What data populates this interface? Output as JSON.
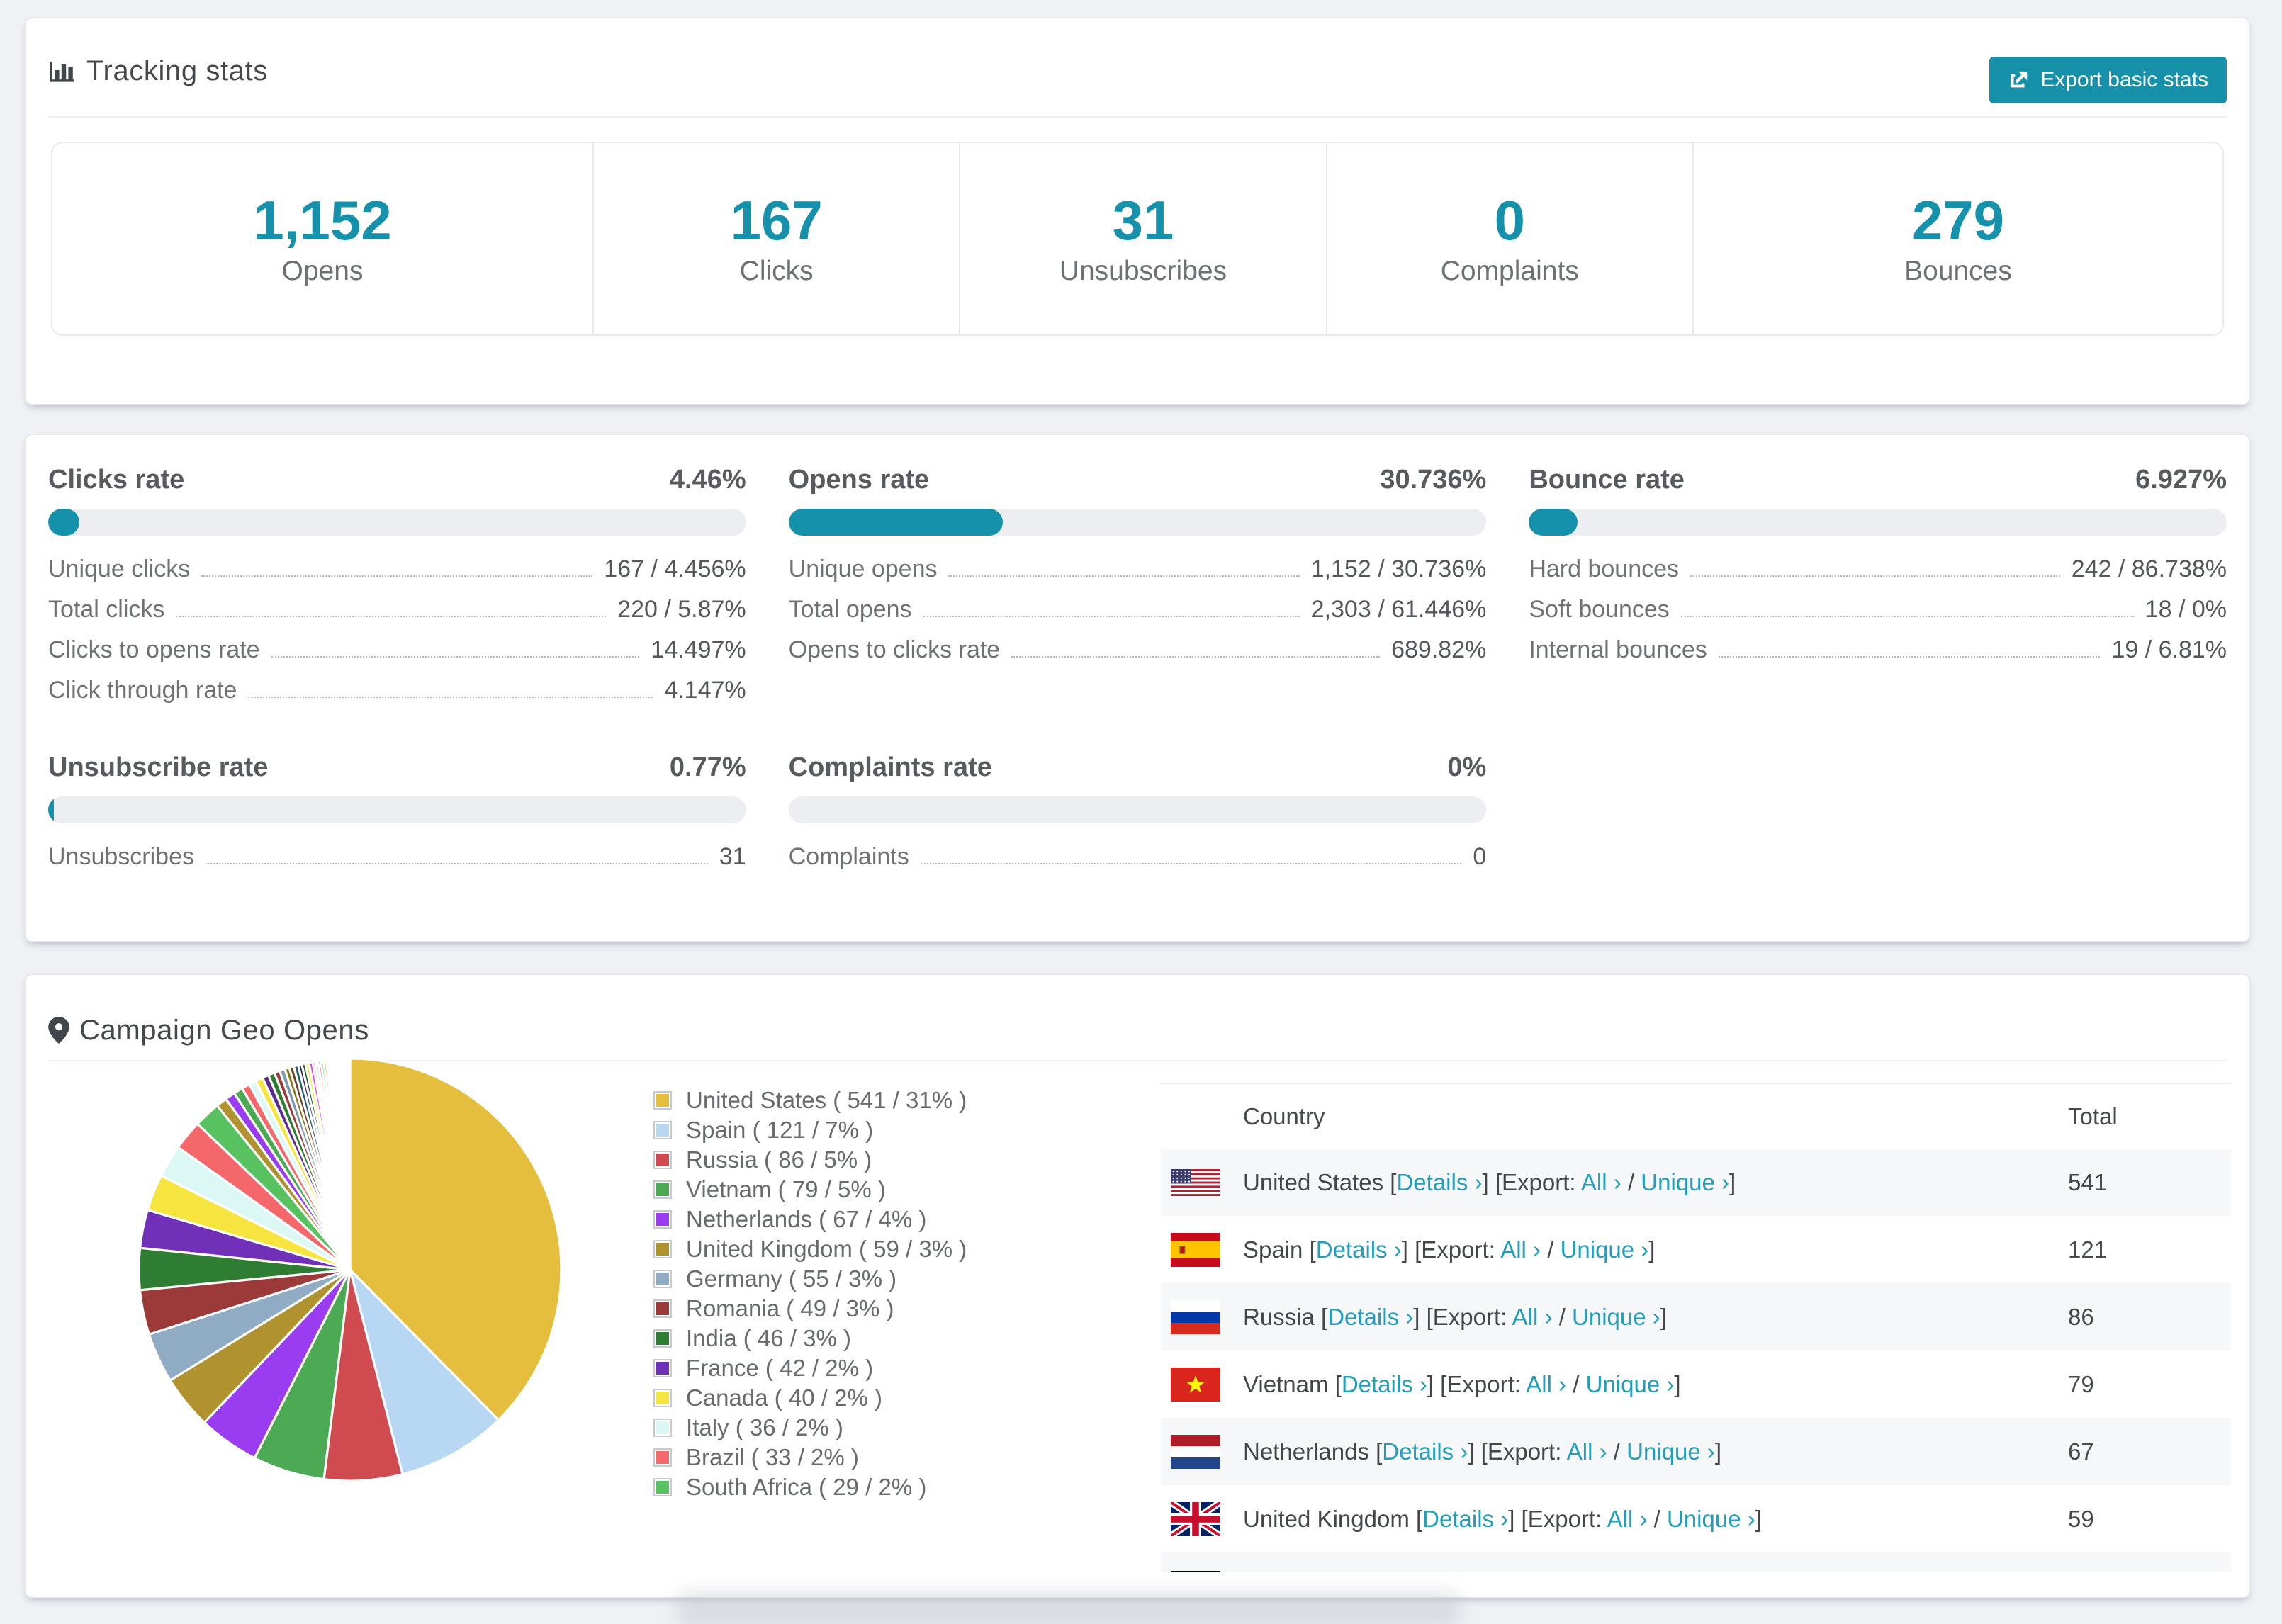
{
  "tracking": {
    "title": "Tracking stats",
    "export_button": "Export basic stats",
    "summary": [
      {
        "value": "1,152",
        "label": "Opens"
      },
      {
        "value": "167",
        "label": "Clicks"
      },
      {
        "value": "31",
        "label": "Unsubscribes"
      },
      {
        "value": "0",
        "label": "Complaints"
      },
      {
        "value": "279",
        "label": "Bounces"
      }
    ]
  },
  "rates": [
    {
      "title": "Clicks rate",
      "percent": "4.46%",
      "bar_percent": 4.46,
      "rows": [
        {
          "label": "Unique clicks",
          "value": "167 / 4.456%"
        },
        {
          "label": "Total clicks",
          "value": "220 / 5.87%"
        },
        {
          "label": "Clicks to opens rate",
          "value": "14.497%"
        },
        {
          "label": "Click through rate",
          "value": "4.147%"
        }
      ]
    },
    {
      "title": "Opens rate",
      "percent": "30.736%",
      "bar_percent": 30.736,
      "rows": [
        {
          "label": "Unique opens",
          "value": "1,152 / 30.736%"
        },
        {
          "label": "Total opens",
          "value": "2,303 / 61.446%"
        },
        {
          "label": "Opens to clicks rate",
          "value": "689.82%"
        }
      ]
    },
    {
      "title": "Bounce rate",
      "percent": "6.927%",
      "bar_percent": 6.927,
      "rows": [
        {
          "label": "Hard bounces",
          "value": "242 / 86.738%"
        },
        {
          "label": "Soft bounces",
          "value": "18 / 0%"
        },
        {
          "label": "Internal bounces",
          "value": "19 / 6.81%"
        }
      ]
    },
    {
      "title": "Unsubscribe rate",
      "percent": "0.77%",
      "bar_percent": 0.77,
      "rows": [
        {
          "label": "Unsubscribes",
          "value": "31"
        }
      ]
    },
    {
      "title": "Complaints rate",
      "percent": "0%",
      "bar_percent": 0,
      "rows": [
        {
          "label": "Complaints",
          "value": "0"
        }
      ]
    }
  ],
  "geo": {
    "title": "Campaign Geo Opens",
    "chart_data": {
      "type": "pie",
      "title": "Campaign Geo Opens",
      "legend_position": "right",
      "countries": [
        {
          "name": "United States",
          "value": 541,
          "pct": "31%",
          "color": "#e5be3d",
          "flag": "us"
        },
        {
          "name": "Spain",
          "value": 121,
          "pct": "7%",
          "color": "#b8d7f2",
          "flag": "es"
        },
        {
          "name": "Russia",
          "value": 86,
          "pct": "5%",
          "color": "#d04b50",
          "flag": "ru"
        },
        {
          "name": "Vietnam",
          "value": 79,
          "pct": "5%",
          "color": "#4caa54",
          "flag": "vn"
        },
        {
          "name": "Netherlands",
          "value": 67,
          "pct": "4%",
          "color": "#9a3cf0",
          "flag": "nl"
        },
        {
          "name": "United Kingdom",
          "value": 59,
          "pct": "3%",
          "color": "#b0922f",
          "flag": "gb"
        },
        {
          "name": "Germany",
          "value": 55,
          "pct": "3%",
          "color": "#90abc4",
          "flag": "de"
        },
        {
          "name": "Romania",
          "value": 49,
          "pct": "3%",
          "color": "#9c3a3a"
        },
        {
          "name": "India",
          "value": 46,
          "pct": "3%",
          "color": "#2f7d33"
        },
        {
          "name": "France",
          "value": 42,
          "pct": "2%",
          "color": "#7030b8"
        },
        {
          "name": "Canada",
          "value": 40,
          "pct": "2%",
          "color": "#f6e53f"
        },
        {
          "name": "Italy",
          "value": 36,
          "pct": "2%",
          "color": "#dcf8f4"
        },
        {
          "name": "Brazil",
          "value": 33,
          "pct": "2%",
          "color": "#f4686c"
        },
        {
          "name": "South Africa",
          "value": 29,
          "pct": "2%",
          "color": "#58c260"
        }
      ],
      "other_slices": {
        "values": [
          12,
          11,
          10,
          9,
          8,
          8,
          7,
          7,
          6,
          6,
          5,
          5,
          5,
          4,
          4,
          4,
          4,
          3,
          3,
          3,
          3,
          3,
          2,
          2,
          2,
          2,
          2,
          2,
          2,
          2,
          1,
          1,
          1,
          1,
          1,
          1,
          1,
          1,
          1,
          1
        ],
        "colors": [
          "#b0922f",
          "#9a3cf0",
          "#4caa54",
          "#f4686c",
          "#dcf8f4",
          "#f6e53f",
          "#5e2d91",
          "#2f7d33",
          "#9c3a3a",
          "#7d99ad",
          "#857119",
          "#6e3f22",
          "#27606b",
          "#2e2a6e",
          "#1d5e31",
          "#f2ee3a",
          "#e23cdc",
          "#f591c3",
          "#a8d3f0",
          "#e04343",
          "#3fcf53",
          "#caa52e",
          "#98c7ed",
          "#d94b4b",
          "#8b5cf6",
          "#34d399",
          "#f87171",
          "#fbbf24",
          "#60a5fa",
          "#c084fc",
          "#4ade80",
          "#f43f5e",
          "#38bdf8",
          "#a3e635",
          "#fb7185",
          "#818cf8",
          "#2dd4bf",
          "#e879f9",
          "#facc15",
          "#94a3b8"
        ]
      }
    },
    "table": {
      "headers": {
        "country": "Country",
        "total": "Total"
      },
      "links": {
        "details": "Details ›",
        "export": "Export:",
        "all": "All ›",
        "unique": "Unique ›"
      }
    }
  }
}
